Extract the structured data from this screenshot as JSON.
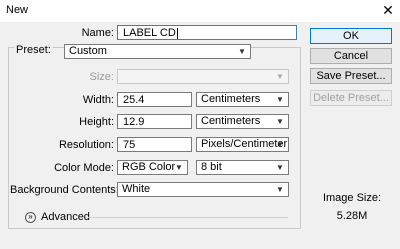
{
  "window": {
    "title": "New",
    "close_glyph": "✕"
  },
  "form": {
    "name": {
      "label": "Name:",
      "value": "LABEL CD"
    },
    "preset": {
      "label": "Preset:",
      "value": "Custom"
    },
    "size": {
      "label": "Size:",
      "value": ""
    },
    "width": {
      "label": "Width:",
      "value": "25.4",
      "unit": "Centimeters"
    },
    "height": {
      "label": "Height:",
      "value": "12.9",
      "unit": "Centimeters"
    },
    "resolution": {
      "label": "Resolution:",
      "value": "75",
      "unit": "Pixels/Centimeter"
    },
    "color_mode": {
      "label": "Color Mode:",
      "mode": "RGB Color",
      "depth": "8 bit"
    },
    "background": {
      "label": "Background Contents:",
      "value": "White"
    },
    "advanced": {
      "label": "Advanced"
    }
  },
  "buttons": {
    "ok": "OK",
    "cancel": "Cancel",
    "save_preset": "Save Preset...",
    "delete_preset": "Delete Preset..."
  },
  "image_size": {
    "label": "Image Size:",
    "value": "5.28M"
  },
  "icons": {
    "dropdown": "chevron-down-icon",
    "advanced": "expand-icon",
    "close": "close-icon"
  }
}
